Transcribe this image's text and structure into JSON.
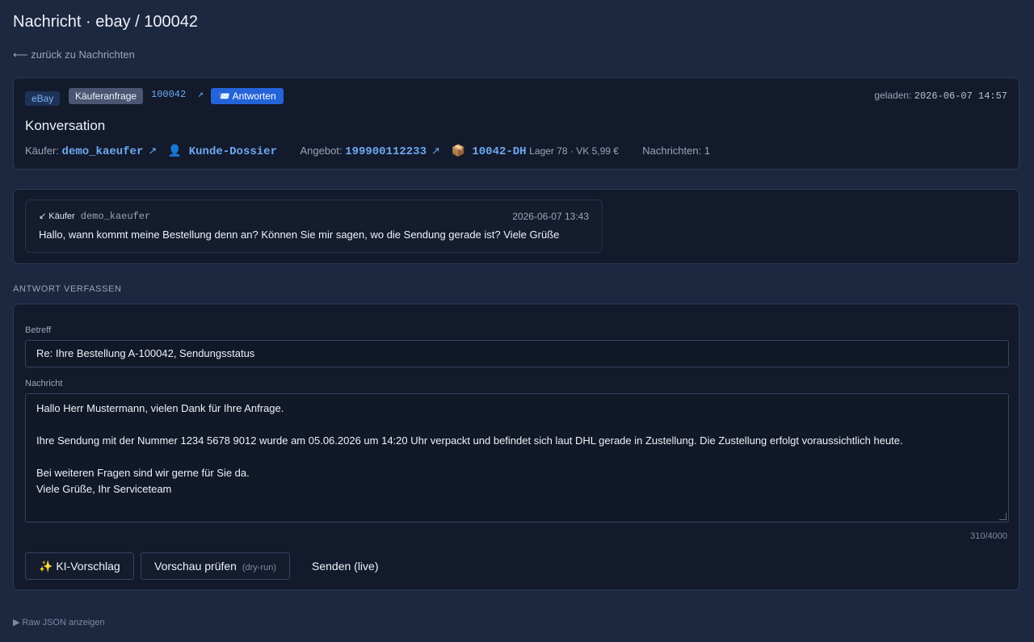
{
  "page": {
    "title": "Nachricht · ebay / 100042",
    "back_link": "⟵ zurück zu Nachrichten"
  },
  "header": {
    "platform_badge": "eBay",
    "type_badge": "Käuferanfrage",
    "order_id": "100042",
    "order_link_icon": "↗",
    "reply_icon": "📨",
    "reply_label": "Antworten",
    "loaded_label": "geladen:",
    "loaded_time": "2026-06-07 14:57",
    "conversation_title": "Konversation",
    "buyer_label": "Käufer:",
    "buyer_name": "demo_kaeufer",
    "buyer_link_icon": "↗",
    "dossier_icon": "👤",
    "dossier_label": "Kunde-Dossier",
    "offer_label": "Angebot:",
    "offer_id": "199900112233",
    "offer_link_icon": "↗",
    "sku_icon": "📦",
    "sku": "10042-DH",
    "stock_info": "Lager 78 · VK 5,99 €",
    "message_count_label": "Nachrichten: 1"
  },
  "thread": {
    "messages": [
      {
        "direction_icon": "↙",
        "role": "Käufer",
        "sender": "demo_kaeufer",
        "date": "2026-06-07 13:43",
        "body": "Hallo, wann kommt meine Bestellung denn an? Können Sie mir sagen, wo die Sendung gerade ist? Viele Grüße"
      }
    ]
  },
  "compose": {
    "section_label": "ANTWORT VERFASSEN",
    "subject_label": "Betreff",
    "subject_value": "Re: Ihre Bestellung A-100042, Sendungsstatus",
    "message_label": "Nachricht",
    "message_value": "Hallo Herr Mustermann, vielen Dank für Ihre Anfrage.\n\nIhre Sendung mit der Nummer 1234 5678 9012 wurde am 05.06.2026 um 14:20 Uhr verpackt und befindet sich laut DHL gerade in Zustellung. Die Zustellung erfolgt voraussichtlich heute.\n\nBei weiteren Fragen sind wir gerne für Sie da.\nViele Grüße, Ihr Serviceteam",
    "char_counter": "310/4000",
    "ai_button_icon": "✨",
    "ai_button_label": "KI-Vorschlag",
    "preview_button_label": "Vorschau prüfen",
    "preview_button_hint": "(dry-run)",
    "send_button_label": "Senden (live)"
  },
  "footer": {
    "raw_json_toggle": "▶  Raw JSON anzeigen"
  },
  "colors": {
    "background": "#1c2740",
    "card": "#121a2c",
    "accent": "#2463d8",
    "link": "#6fa8f0"
  }
}
